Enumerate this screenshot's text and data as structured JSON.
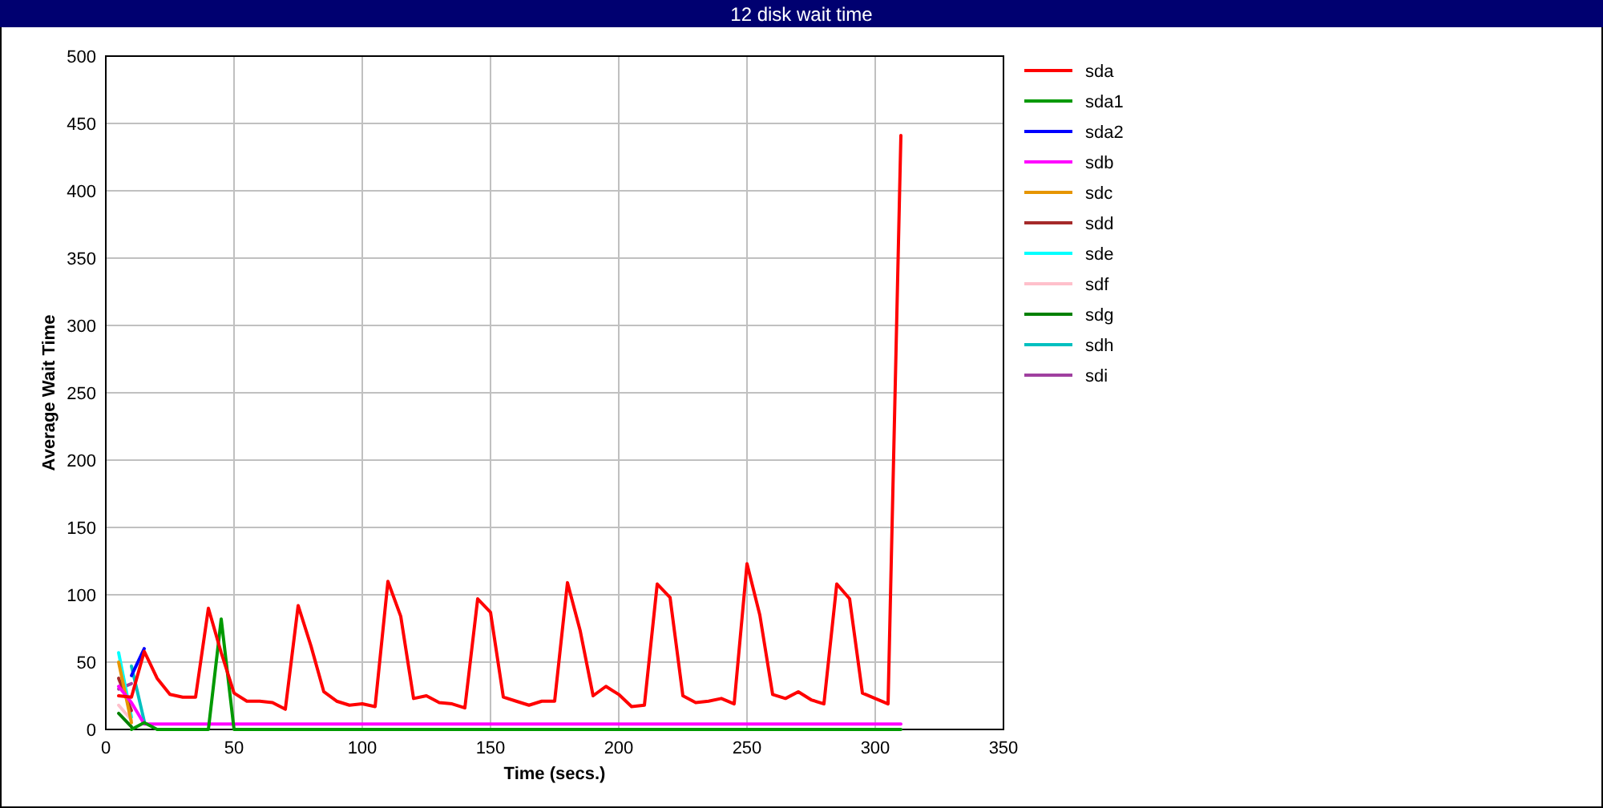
{
  "window": {
    "title": "12 disk wait time"
  },
  "chart": {
    "chart_data": {
      "type": "line",
      "xlabel": "Time (secs.)",
      "ylabel": "Average Wait Time",
      "xlim": [
        0,
        350
      ],
      "ylim": [
        0,
        500
      ],
      "grid": true,
      "legend": true,
      "xticks": [
        0,
        50,
        100,
        150,
        200,
        250,
        300,
        350
      ],
      "yticks": [
        0,
        50,
        100,
        150,
        200,
        250,
        300,
        350,
        400,
        450,
        500
      ],
      "x": [
        5,
        10,
        15,
        20,
        25,
        30,
        35,
        40,
        45,
        50,
        55,
        60,
        65,
        70,
        75,
        80,
        85,
        90,
        95,
        100,
        105,
        110,
        115,
        120,
        125,
        130,
        135,
        140,
        145,
        150,
        155,
        160,
        165,
        170,
        175,
        180,
        185,
        190,
        195,
        200,
        205,
        210,
        215,
        220,
        225,
        230,
        235,
        240,
        245,
        250,
        255,
        260,
        265,
        270,
        275,
        280,
        285,
        290,
        295,
        300,
        305,
        310
      ],
      "series": [
        {
          "name": "sda",
          "color": "#ff0000",
          "values": [
            25,
            24,
            58,
            38,
            26,
            24,
            24,
            90,
            57,
            27,
            21,
            21,
            20,
            15,
            92,
            62,
            28,
            21,
            18,
            19,
            17,
            110,
            84,
            23,
            25,
            20,
            19,
            16,
            97,
            87,
            24,
            21,
            18,
            21,
            21,
            109,
            73,
            25,
            32,
            26,
            17,
            18,
            108,
            98,
            25,
            20,
            21,
            23,
            19,
            123,
            85,
            26,
            23,
            28,
            22,
            19,
            108,
            97,
            27,
            23,
            19,
            441
          ]
        },
        {
          "name": "sda1",
          "color": "#009900",
          "values": [
            null,
            0,
            5,
            0,
            0,
            0,
            0,
            0,
            82,
            0,
            0,
            0,
            0,
            0,
            0,
            0,
            0,
            0,
            0,
            0,
            0,
            0,
            0,
            0,
            0,
            0,
            0,
            0,
            0,
            0,
            0,
            0,
            0,
            0,
            0,
            0,
            0,
            0,
            0,
            0,
            0,
            0,
            0,
            0,
            0,
            0,
            0,
            0,
            0,
            0,
            0,
            0,
            0,
            0,
            0,
            0,
            0,
            0,
            0,
            0,
            0,
            0
          ]
        },
        {
          "name": "sda2",
          "color": "#0000ff",
          "values": [
            null,
            40,
            60,
            null,
            null,
            null,
            null,
            null,
            null,
            null,
            null,
            null,
            null,
            null,
            null,
            null,
            null,
            null,
            null,
            null,
            null,
            null,
            null,
            null,
            null,
            null,
            null,
            null,
            null,
            null,
            null,
            null,
            null,
            null,
            null,
            null,
            null,
            null,
            null,
            null,
            null,
            null,
            null,
            null,
            null,
            null,
            null,
            null,
            null,
            null,
            null,
            null,
            null,
            null,
            null,
            null,
            null,
            null,
            null,
            null,
            null,
            null
          ]
        },
        {
          "name": "sdb",
          "color": "#ff00ff",
          "values": [
            32,
            20,
            4,
            4,
            4,
            4,
            4,
            4,
            4,
            4,
            4,
            4,
            4,
            4,
            4,
            4,
            4,
            4,
            4,
            4,
            4,
            4,
            4,
            4,
            4,
            4,
            4,
            4,
            4,
            4,
            4,
            4,
            4,
            4,
            4,
            4,
            4,
            4,
            4,
            4,
            4,
            4,
            4,
            4,
            4,
            4,
            4,
            4,
            4,
            4,
            4,
            4,
            4,
            4,
            4,
            4,
            4,
            4,
            4,
            4,
            4,
            4
          ]
        },
        {
          "name": "sdc",
          "color": "#e69500",
          "values": [
            50,
            5,
            null,
            null,
            null,
            null,
            null,
            null,
            null,
            null,
            null,
            null,
            null,
            null,
            null,
            null,
            null,
            null,
            null,
            null,
            null,
            null,
            null,
            null,
            null,
            null,
            null,
            null,
            null,
            null,
            null,
            null,
            null,
            null,
            null,
            null,
            null,
            null,
            null,
            null,
            null,
            null,
            null,
            null,
            null,
            null,
            null,
            null,
            null,
            null,
            null,
            null,
            null,
            null,
            null,
            null,
            null,
            null,
            null,
            null,
            null,
            null
          ]
        },
        {
          "name": "sdd",
          "color": "#a52a2a",
          "values": [
            38,
            14,
            null,
            null,
            null,
            null,
            null,
            null,
            null,
            null,
            null,
            null,
            null,
            null,
            null,
            null,
            null,
            null,
            null,
            null,
            null,
            null,
            null,
            null,
            null,
            null,
            null,
            null,
            null,
            null,
            null,
            null,
            null,
            null,
            null,
            null,
            null,
            null,
            null,
            null,
            null,
            null,
            null,
            null,
            null,
            null,
            null,
            null,
            null,
            null,
            null,
            null,
            null,
            null,
            null,
            null,
            null,
            null,
            null,
            null,
            null,
            null
          ]
        },
        {
          "name": "sde",
          "color": "#00ffff",
          "values": [
            57,
            9,
            null,
            null,
            null,
            null,
            null,
            null,
            null,
            null,
            null,
            null,
            null,
            null,
            null,
            null,
            null,
            null,
            null,
            null,
            null,
            null,
            null,
            null,
            null,
            null,
            null,
            null,
            null,
            null,
            null,
            null,
            null,
            null,
            null,
            null,
            null,
            null,
            null,
            null,
            null,
            null,
            null,
            null,
            null,
            null,
            null,
            null,
            null,
            null,
            null,
            null,
            null,
            null,
            null,
            null,
            null,
            null,
            null,
            null,
            null,
            null
          ]
        },
        {
          "name": "sdf",
          "color": "#ffc0cb",
          "values": [
            18,
            7,
            null,
            null,
            null,
            null,
            null,
            null,
            null,
            null,
            null,
            null,
            null,
            null,
            null,
            null,
            null,
            null,
            null,
            null,
            null,
            null,
            null,
            null,
            null,
            null,
            null,
            null,
            null,
            null,
            null,
            null,
            null,
            null,
            null,
            null,
            null,
            null,
            null,
            null,
            null,
            null,
            null,
            null,
            null,
            null,
            null,
            null,
            null,
            null,
            null,
            null,
            null,
            null,
            null,
            null,
            null,
            null,
            null,
            null,
            null,
            null
          ]
        },
        {
          "name": "sdg",
          "color": "#008000",
          "values": [
            12,
            2,
            null,
            null,
            null,
            null,
            null,
            null,
            null,
            null,
            null,
            null,
            null,
            null,
            null,
            null,
            null,
            null,
            null,
            null,
            null,
            null,
            null,
            null,
            null,
            null,
            null,
            null,
            null,
            null,
            null,
            null,
            null,
            null,
            null,
            null,
            null,
            null,
            null,
            null,
            null,
            null,
            null,
            null,
            null,
            null,
            null,
            null,
            null,
            null,
            null,
            null,
            null,
            null,
            null,
            null,
            null,
            null,
            null,
            null,
            null,
            null
          ]
        },
        {
          "name": "sdh",
          "color": "#00c0c0",
          "values": [
            null,
            47,
            6,
            null,
            null,
            null,
            null,
            null,
            null,
            null,
            null,
            null,
            null,
            null,
            null,
            null,
            null,
            null,
            null,
            null,
            null,
            null,
            null,
            null,
            null,
            null,
            null,
            null,
            null,
            null,
            null,
            null,
            null,
            null,
            null,
            null,
            null,
            null,
            null,
            null,
            null,
            null,
            null,
            null,
            null,
            null,
            null,
            null,
            null,
            null,
            null,
            null,
            null,
            null,
            null,
            null,
            null,
            null,
            null,
            null,
            null,
            null
          ]
        },
        {
          "name": "sdi",
          "color": "#a040a0",
          "values": [
            30,
            34,
            null,
            null,
            null,
            null,
            null,
            null,
            null,
            null,
            null,
            null,
            null,
            null,
            null,
            null,
            null,
            null,
            null,
            null,
            null,
            null,
            null,
            null,
            null,
            null,
            null,
            null,
            null,
            null,
            null,
            null,
            null,
            null,
            null,
            null,
            null,
            null,
            null,
            null,
            null,
            null,
            null,
            null,
            null,
            null,
            null,
            null,
            null,
            null,
            null,
            null,
            null,
            null,
            null,
            null,
            null,
            null,
            null,
            null,
            null,
            null
          ]
        }
      ]
    }
  }
}
